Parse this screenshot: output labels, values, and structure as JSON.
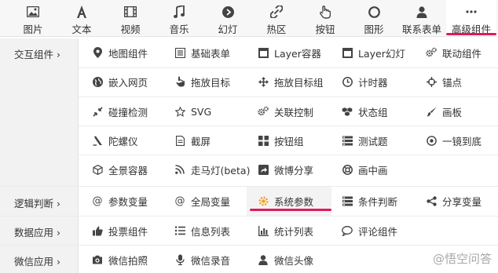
{
  "toolbar": {
    "items": [
      {
        "label": "图片",
        "icon": "image-icon"
      },
      {
        "label": "文本",
        "icon": "text-icon"
      },
      {
        "label": "视频",
        "icon": "video-icon"
      },
      {
        "label": "音乐",
        "icon": "music-icon"
      },
      {
        "label": "幻灯",
        "icon": "slideshow-icon"
      },
      {
        "label": "热区",
        "icon": "hotspot-link-icon"
      },
      {
        "label": "按钮",
        "icon": "hand-pointer-icon"
      },
      {
        "label": "图形",
        "icon": "circle-shape-icon"
      },
      {
        "label": "联系表单",
        "icon": "person-icon"
      },
      {
        "label": "高级组件",
        "icon": "more-dots-icon"
      }
    ]
  },
  "categories": [
    {
      "label": "交互组件 ›"
    },
    {
      "label": "逻辑判断 ›"
    },
    {
      "label": "数据应用 ›"
    },
    {
      "label": "微信应用 ›"
    }
  ],
  "components": {
    "interaction": [
      {
        "label": "地图组件"
      },
      {
        "label": "基础表单"
      },
      {
        "label": "Layer容器"
      },
      {
        "label": "Layer幻灯"
      },
      {
        "label": "联动组件"
      },
      {
        "label": "嵌入网页"
      },
      {
        "label": "拖放目标"
      },
      {
        "label": "拖放目标组"
      },
      {
        "label": "计时器"
      },
      {
        "label": "锚点"
      },
      {
        "label": "碰撞检测"
      },
      {
        "label": "SVG"
      },
      {
        "label": "关联控制"
      },
      {
        "label": "状态组"
      },
      {
        "label": "画板"
      },
      {
        "label": "陀螺仪"
      },
      {
        "label": "截屏"
      },
      {
        "label": "按钮组"
      },
      {
        "label": "测试题"
      },
      {
        "label": "一镜到底"
      },
      {
        "label": "全景容器"
      },
      {
        "label": "走马灯(beta)"
      },
      {
        "label": "微博分享"
      },
      {
        "label": "画中画"
      }
    ],
    "logic": [
      {
        "label": "参数变量"
      },
      {
        "label": "全局变量"
      },
      {
        "label": "系统参数"
      },
      {
        "label": "条件判断"
      },
      {
        "label": "分享变量"
      }
    ],
    "data": [
      {
        "label": "投票组件"
      },
      {
        "label": "信息列表"
      },
      {
        "label": "统计列表"
      },
      {
        "label": "评论组件"
      }
    ],
    "wechat": [
      {
        "label": "微信拍照"
      },
      {
        "label": "微信录音"
      },
      {
        "label": "微信头像"
      }
    ]
  },
  "watermark": "@悟空问答",
  "colors": {
    "accent": "#e0195a",
    "highlight_gear": "#f0a020"
  }
}
